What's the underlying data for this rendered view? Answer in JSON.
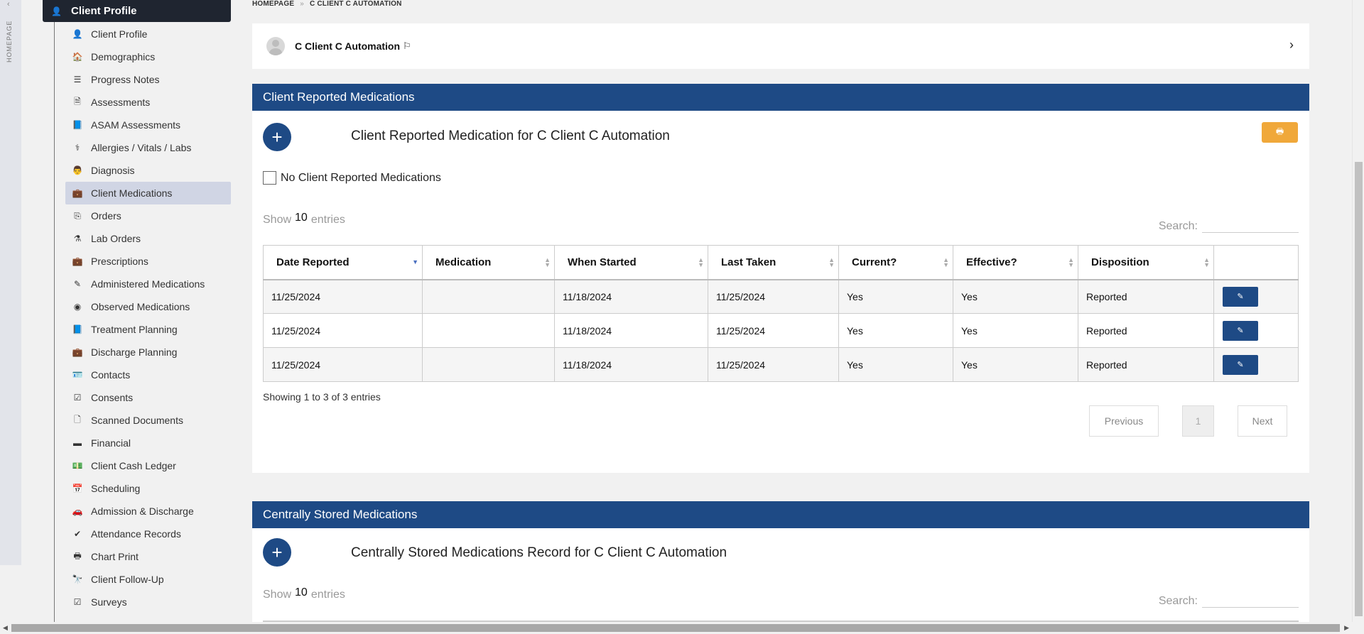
{
  "rail": {
    "label": "HOMEPAGE"
  },
  "sidebar": {
    "header": "Client Profile",
    "items": [
      {
        "label": "Client Profile",
        "icon": "person-icon",
        "glyph": "👤"
      },
      {
        "label": "Demographics",
        "icon": "home-icon",
        "glyph": "🏠"
      },
      {
        "label": "Progress Notes",
        "icon": "list-icon",
        "glyph": "☰"
      },
      {
        "label": "Assessments",
        "icon": "document-icon",
        "glyph": "🗎"
      },
      {
        "label": "ASAM Assessments",
        "icon": "book-icon",
        "glyph": "📘"
      },
      {
        "label": "Allergies / Vitals / Labs",
        "icon": "stethoscope-icon",
        "glyph": "⚕"
      },
      {
        "label": "Diagnosis",
        "icon": "user-md-icon",
        "glyph": "👨"
      },
      {
        "label": "Client Medications",
        "icon": "medkit-icon",
        "glyph": "💼",
        "active": true
      },
      {
        "label": "Orders",
        "icon": "copy-icon",
        "glyph": "⎘"
      },
      {
        "label": "Lab Orders",
        "icon": "flask-icon",
        "glyph": "⚗"
      },
      {
        "label": "Prescriptions",
        "icon": "medkit-icon",
        "glyph": "💼"
      },
      {
        "label": "Administered Medications",
        "icon": "eyedropper-icon",
        "glyph": "✎"
      },
      {
        "label": "Observed Medications",
        "icon": "eye-icon",
        "glyph": "◉"
      },
      {
        "label": "Treatment Planning",
        "icon": "book-icon",
        "glyph": "📘"
      },
      {
        "label": "Discharge Planning",
        "icon": "briefcase-icon",
        "glyph": "💼"
      },
      {
        "label": "Contacts",
        "icon": "address-card-icon",
        "glyph": "🪪"
      },
      {
        "label": "Consents",
        "icon": "check-square-icon",
        "glyph": "☑"
      },
      {
        "label": "Scanned Documents",
        "icon": "file-icon",
        "glyph": "🗋"
      },
      {
        "label": "Financial",
        "icon": "credit-card-icon",
        "glyph": "▬"
      },
      {
        "label": "Client Cash Ledger",
        "icon": "money-icon",
        "glyph": "💵"
      },
      {
        "label": "Scheduling",
        "icon": "calendar-icon",
        "glyph": "📅"
      },
      {
        "label": "Admission & Discharge",
        "icon": "car-icon",
        "glyph": "🚗"
      },
      {
        "label": "Attendance Records",
        "icon": "check-icon",
        "glyph": "✔"
      },
      {
        "label": "Chart Print",
        "icon": "print-icon",
        "glyph": "🖶"
      },
      {
        "label": "Client Follow-Up",
        "icon": "binoculars-icon",
        "glyph": "🔭"
      },
      {
        "label": "Surveys",
        "icon": "check-square-icon",
        "glyph": "☑"
      }
    ]
  },
  "breadcrumb": {
    "home": "HOMEPAGE",
    "sep": "»",
    "current": "C CLIENT C AUTOMATION"
  },
  "client": {
    "name": "C Client C Automation"
  },
  "reported": {
    "header": "Client Reported Medications",
    "title": "Client Reported Medication for C Client C Automation",
    "no_meds_label": "No Client Reported Medications",
    "show_prefix": "Show",
    "page_len": "10",
    "show_suffix": "entries",
    "search_label": "Search:",
    "columns": [
      "Date Reported",
      "Medication",
      "When Started",
      "Last Taken",
      "Current?",
      "Effective?",
      "Disposition",
      ""
    ],
    "rows": [
      [
        "11/25/2024",
        "",
        "11/18/2024",
        "11/25/2024",
        "Yes",
        "Yes",
        "Reported"
      ],
      [
        "11/25/2024",
        "",
        "11/18/2024",
        "11/25/2024",
        "Yes",
        "Yes",
        "Reported"
      ],
      [
        "11/25/2024",
        "",
        "11/18/2024",
        "11/25/2024",
        "Yes",
        "Yes",
        "Reported"
      ]
    ],
    "info": "Showing 1 to 3 of 3 entries",
    "prev": "Previous",
    "page": "1",
    "next": "Next"
  },
  "central": {
    "header": "Centrally Stored Medications",
    "title": "Centrally Stored Medications Record for C Client C Automation",
    "show_prefix": "Show",
    "page_len": "10",
    "show_suffix": "entries",
    "search_label": "Search:"
  }
}
